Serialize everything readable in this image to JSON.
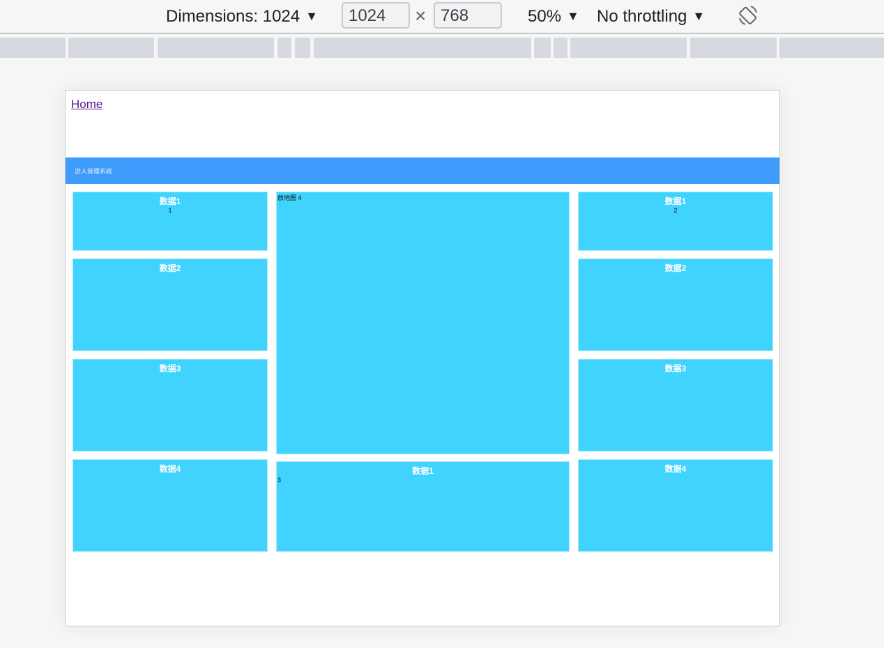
{
  "devtools": {
    "dimensions_label": "Dimensions: 1024",
    "width_value": "1024",
    "times_symbol": "×",
    "height_value": "768",
    "zoom_label": "50%",
    "throttling_label": "No throttling",
    "dropdown_glyph": "▼",
    "rotate_icon": "rotate-device-icon"
  },
  "page": {
    "home_link": "Home",
    "banner_text": "进入管理系統",
    "left_panels": [
      {
        "title": "数据1",
        "value": "1"
      },
      {
        "title": "数据2",
        "value": ""
      },
      {
        "title": "数据3",
        "value": ""
      },
      {
        "title": "数据4",
        "value": ""
      }
    ],
    "center_map": {
      "label": "放地图 4"
    },
    "center_bottom": {
      "title": "数据1",
      "value": "3"
    },
    "right_panels": [
      {
        "title": "数据1",
        "value": "2"
      },
      {
        "title": "数据2",
        "value": ""
      },
      {
        "title": "数据3",
        "value": ""
      },
      {
        "title": "数据4",
        "value": ""
      }
    ]
  }
}
